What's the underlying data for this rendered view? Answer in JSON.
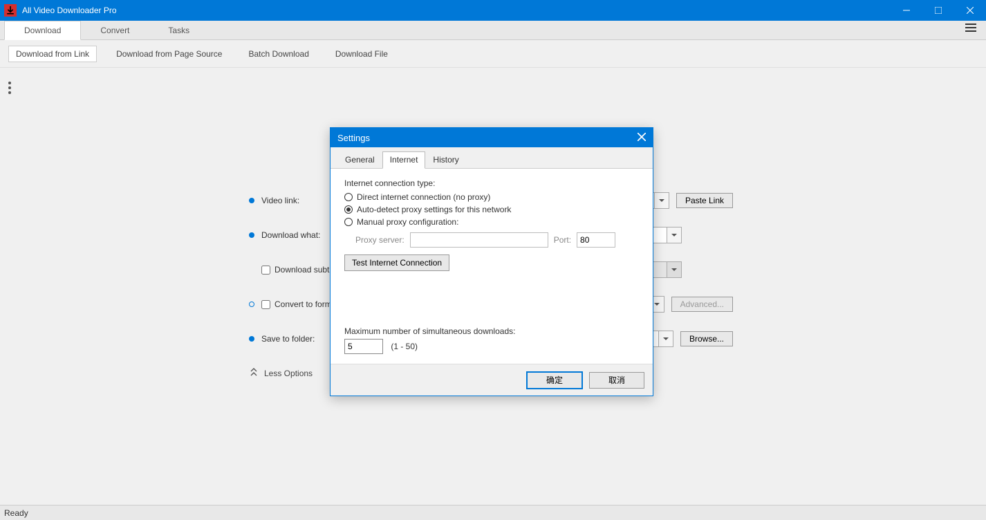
{
  "app": {
    "title": "All Video Downloader Pro"
  },
  "mainTabs": {
    "download": "Download",
    "convert": "Convert",
    "tasks": "Tasks"
  },
  "subTabs": {
    "fromLink": "Download from Link",
    "fromSource": "Download from Page Source",
    "batch": "Batch Download",
    "file": "Download File"
  },
  "form": {
    "videoLink": "Video link:",
    "pasteLink": "Paste Link",
    "downloadWhat": "Download what:",
    "downloadSubtitles": "Download subtitles",
    "convertFormat": "Convert to format",
    "advanced": "Advanced...",
    "saveFolder": "Save to folder:",
    "browse": "Browse...",
    "lessOptions": "Less Options"
  },
  "status": "Ready",
  "settings": {
    "title": "Settings",
    "tabs": {
      "general": "General",
      "internet": "Internet",
      "history": "History"
    },
    "connTypeLabel": "Internet connection type:",
    "optDirect": "Direct internet connection (no proxy)",
    "optAuto": "Auto-detect proxy settings for this network",
    "optManual": "Manual proxy configuration:",
    "proxyServer": "Proxy server:",
    "port": "Port:",
    "portValue": "80",
    "testBtn": "Test Internet Connection",
    "maxDownloadsLabel": "Maximum number of simultaneous downloads:",
    "maxDownloadsValue": "5",
    "maxDownloadsRange": "(1 - 50)",
    "ok": "确定",
    "cancel": "取消"
  }
}
